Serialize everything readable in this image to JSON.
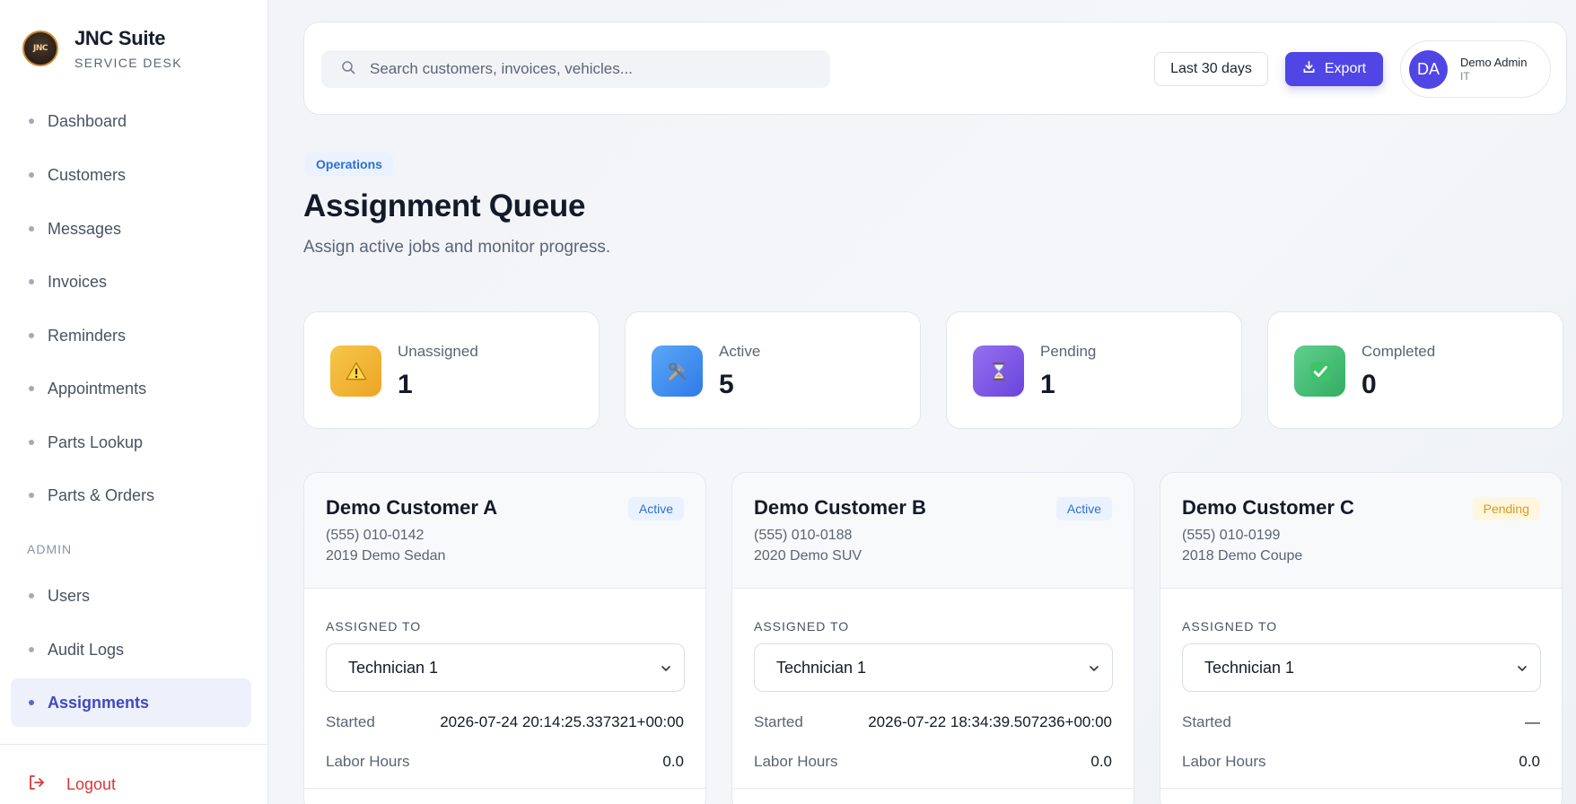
{
  "brand": {
    "logo_text": "JNC",
    "name": "JNC Suite",
    "subtitle": "SERVICE DESK"
  },
  "sidebar": {
    "items": [
      {
        "label": "Dashboard"
      },
      {
        "label": "Customers"
      },
      {
        "label": "Messages"
      },
      {
        "label": "Invoices"
      },
      {
        "label": "Reminders"
      },
      {
        "label": "Appointments"
      },
      {
        "label": "Parts Lookup"
      },
      {
        "label": "Parts & Orders"
      }
    ],
    "admin_label": "ADMIN",
    "admin_items": [
      {
        "label": "Users"
      },
      {
        "label": "Audit Logs"
      },
      {
        "label": "Assignments",
        "active": true
      }
    ],
    "logout_label": "Logout"
  },
  "topbar": {
    "search_placeholder": "Search customers, invoices, vehicles...",
    "range_label": "Last 30 days",
    "export_label": "Export",
    "user": {
      "initials": "DA",
      "name": "Demo Admin",
      "role": "IT"
    }
  },
  "header": {
    "eyebrow": "Operations",
    "title": "Assignment Queue",
    "subtitle": "Assign active jobs and monitor progress."
  },
  "stats": [
    {
      "label": "Unassigned",
      "value": "1",
      "icon": "warning-icon",
      "color": "#f2b632"
    },
    {
      "label": "Active",
      "value": "5",
      "icon": "tools-icon",
      "color": "#3b8cf2"
    },
    {
      "label": "Pending",
      "value": "1",
      "icon": "hourglass-icon",
      "color": "#7c55e6"
    },
    {
      "label": "Completed",
      "value": "0",
      "icon": "check-icon",
      "color": "#3dbb6e"
    }
  ],
  "jobs": [
    {
      "customer": "Demo Customer A",
      "phone": "(555) 010-0142",
      "vehicle": "2019 Demo Sedan",
      "status": "Active",
      "assigned_label": "ASSIGNED TO",
      "technician": "Technician 1",
      "started_label": "Started",
      "started": "2026-07-24 20:14:25.337321+00:00",
      "labor_label": "Labor Hours",
      "labor_hours": "0.0"
    },
    {
      "customer": "Demo Customer B",
      "phone": "(555) 010-0188",
      "vehicle": "2020 Demo SUV",
      "status": "Active",
      "assigned_label": "ASSIGNED TO",
      "technician": "Technician 1",
      "started_label": "Started",
      "started": "2026-07-22 18:34:39.507236+00:00",
      "labor_label": "Labor Hours",
      "labor_hours": "0.0"
    },
    {
      "customer": "Demo Customer C",
      "phone": "(555) 010-0199",
      "vehicle": "2018 Demo Coupe",
      "status": "Pending",
      "assigned_label": "ASSIGNED TO",
      "technician": "Technician 1",
      "started_label": "Started",
      "started": "—",
      "labor_label": "Labor Hours",
      "labor_hours": "0.0"
    }
  ]
}
